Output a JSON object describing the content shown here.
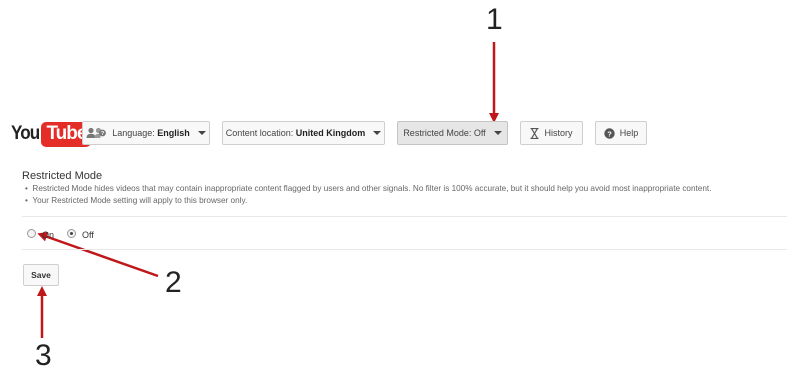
{
  "annotations": {
    "callout_1": "1",
    "callout_2": "2",
    "callout_3": "3"
  },
  "logo": {
    "you": "You",
    "tube": "Tube"
  },
  "toolbar": {
    "language_prefix": "Language:",
    "language_value": "English",
    "location_prefix": "Content location:",
    "location_value": "United Kingdom",
    "restricted_label": "Restricted Mode: Off",
    "history_label": "History",
    "help_label": "Help"
  },
  "restricted_mode": {
    "title": "Restricted Mode",
    "bullets": [
      "Restricted Mode hides videos that may contain inappropriate content flagged by users and other signals. No filter is 100% accurate, but it should help you avoid most inappropriate content.",
      "Your Restricted Mode setting will apply to this browser only."
    ],
    "option_on": "On",
    "option_off": "Off",
    "selected": "Off",
    "save_label": "Save"
  },
  "colors": {
    "arrow": "#c0171a",
    "logo_red": "#e52d27"
  },
  "icons": {
    "language": "people-chat-icon",
    "history": "hourglass-icon",
    "help": "question-circle-icon"
  }
}
